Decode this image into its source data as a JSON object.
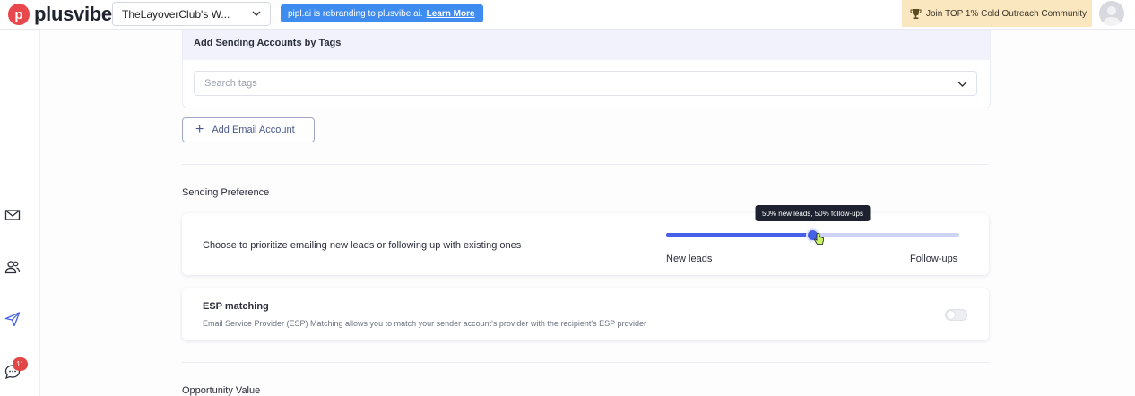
{
  "brand": {
    "name": "plusvibe",
    "mark": "p"
  },
  "workspace": {
    "selected": "TheLayoverClub's W..."
  },
  "banner": {
    "text": "pipl.ai is rebranding to plusvibe.ai.",
    "link": "Learn More",
    "color": "#3f8cf0"
  },
  "community": {
    "text": "Join TOP 1% Cold Outreach Community"
  },
  "sidebar": {
    "icons": [
      "mail-icon",
      "users-icon",
      "send-icon",
      "chat-icon"
    ],
    "chat_badge": "11"
  },
  "tags_section": {
    "title": "Add Sending Accounts by Tags",
    "search_placeholder": "Search tags"
  },
  "add_email_button": {
    "label": "Add Email Account"
  },
  "sending_preference": {
    "title": "Sending Preference",
    "description": "Choose to prioritize emailing new leads or following up with existing ones",
    "slider": {
      "value_percent": 50,
      "tooltip": "50% new leads, 50% follow-ups",
      "left_label": "New leads",
      "right_label": "Follow-ups"
    }
  },
  "esp_matching": {
    "title": "ESP matching",
    "description": "Email Service Provider (ESP) Matching allows you to match your sender account's provider with the recipient's ESP provider",
    "enabled": false
  },
  "opportunity": {
    "title": "Opportunity Value"
  },
  "colors": {
    "accent": "#4660e6",
    "badge": "#e24646",
    "community_bg": "#fbe7bf"
  }
}
